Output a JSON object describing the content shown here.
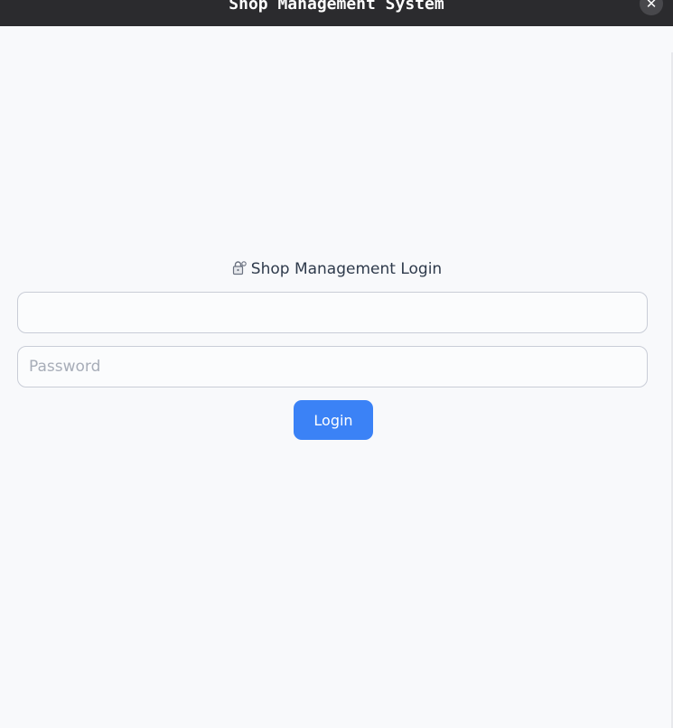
{
  "window": {
    "title": "Shop Management System",
    "close_label": "✕"
  },
  "login": {
    "heading": "Shop Management Login",
    "heading_icon": "lock-icon",
    "username": {
      "value": "",
      "placeholder": ""
    },
    "password": {
      "value": "",
      "placeholder": "Password"
    },
    "submit_label": "Login"
  },
  "colors": {
    "titlebar": "#2b2b2e",
    "background": "#f8f9fb",
    "accent": "#3b82f6",
    "field_border": "#c9cdd7"
  }
}
